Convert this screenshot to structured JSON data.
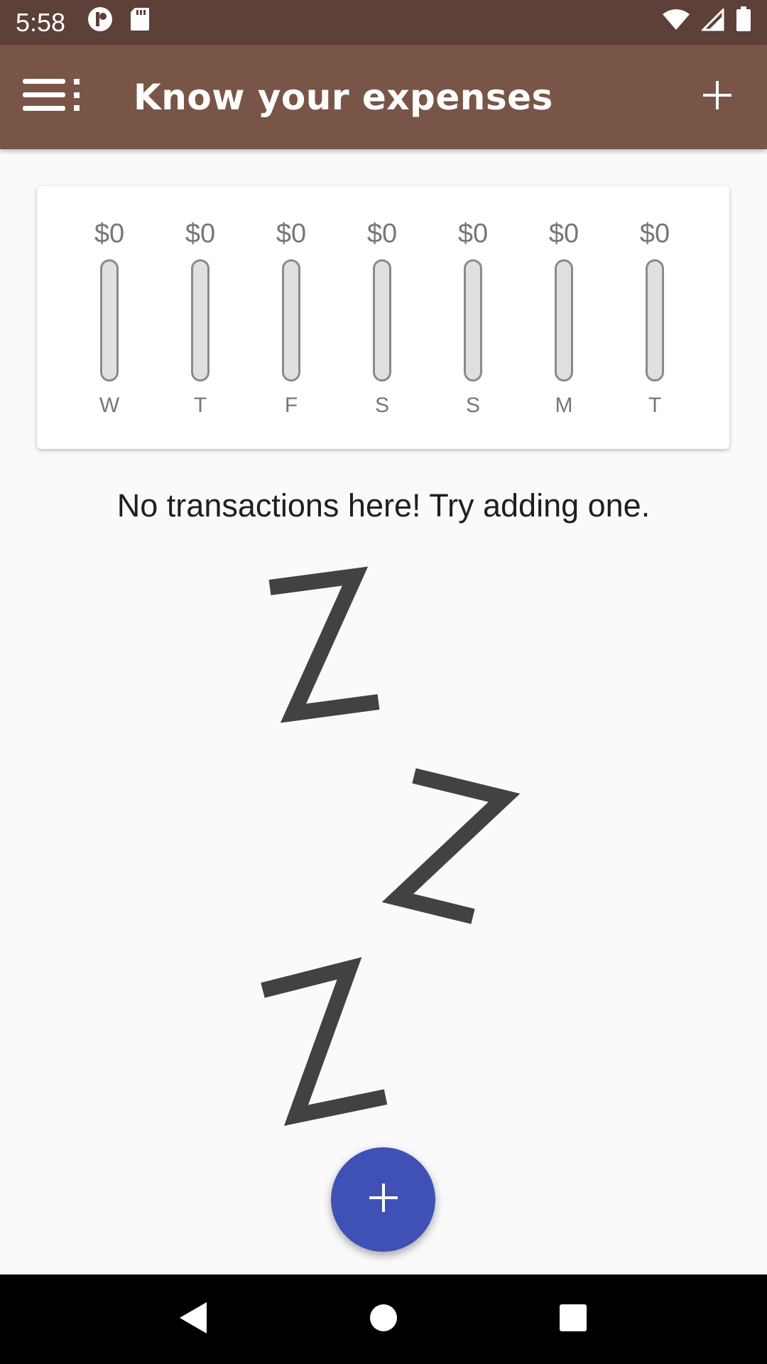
{
  "status_bar": {
    "time": "5:58"
  },
  "app_bar": {
    "title": "Know your expenses"
  },
  "chart_data": {
    "type": "bar",
    "categories": [
      "W",
      "T",
      "F",
      "S",
      "S",
      "M",
      "T"
    ],
    "values": [
      0,
      0,
      0,
      0,
      0,
      0,
      0
    ],
    "value_labels": [
      "$0",
      "$0",
      "$0",
      "$0",
      "$0",
      "$0",
      "$0"
    ]
  },
  "empty_state": {
    "message": "No transactions here! Try adding one."
  },
  "colors": {
    "status_bar": "#5d4037",
    "app_bar": "#795548",
    "fab": "#3f51b5",
    "zzz": "#424242"
  },
  "icons": {
    "menu": "menu-icon",
    "add": "plus-icon",
    "fab": "plus-icon",
    "back": "back-triangle-icon",
    "home": "home-circle-icon",
    "recents": "recents-square-icon"
  }
}
